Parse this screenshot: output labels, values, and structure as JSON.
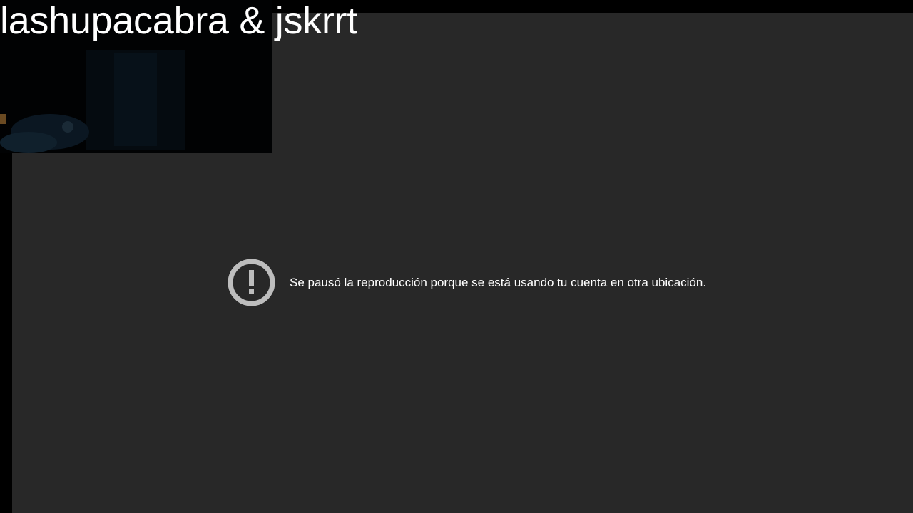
{
  "overlay": {
    "title": "lashupacabra & jskrrt"
  },
  "player": {
    "error_message": "Se pausó la reproducción porque se está usando tu cuenta en otra ubicación.",
    "error_icon": "exclamation-circle-icon"
  },
  "colors": {
    "background": "#000000",
    "player_background": "#282828",
    "icon_color": "#bdbdbd",
    "text_color": "#ffffff"
  }
}
